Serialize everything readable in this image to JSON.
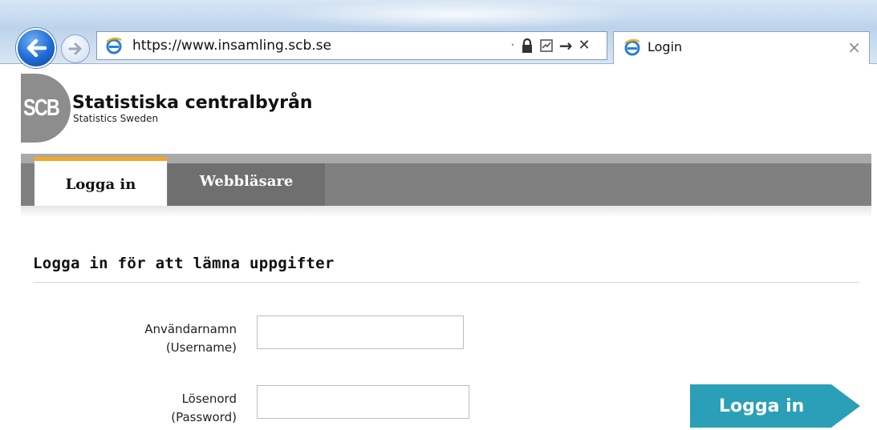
{
  "browser": {
    "url": "https://www.insamling.scb.se",
    "tab_title": "Login",
    "tab_close_glyph": "×",
    "icons": {
      "back": "back-arrow-icon",
      "forward": "forward-arrow-icon",
      "site": "ie-logo-icon",
      "lock": "lock-icon",
      "compat": "compatibility-view-icon",
      "go": "go-arrow-icon",
      "stop": "stop-icon"
    },
    "glyphs": {
      "dot": "·",
      "go": "→",
      "stop": "✕"
    }
  },
  "header": {
    "logo_text": "SCB",
    "org_name": "Statistiska centralbyrån",
    "org_subtitle": "Statistics Sweden"
  },
  "nav": {
    "tabs": [
      {
        "label": "Logga in",
        "active": true
      },
      {
        "label": "Webbläsare",
        "active": false
      }
    ],
    "accent_color": "#f5a623"
  },
  "form": {
    "heading": "Logga in för att lämna uppgifter",
    "username": {
      "label_line1": "Användarnamn",
      "label_line2": "(Username)",
      "value": ""
    },
    "password": {
      "label_line1": "Lösenord",
      "label_line2": "(Password)",
      "value": ""
    },
    "submit_label": "Logga in",
    "submit_color": "#2a9fb7"
  }
}
